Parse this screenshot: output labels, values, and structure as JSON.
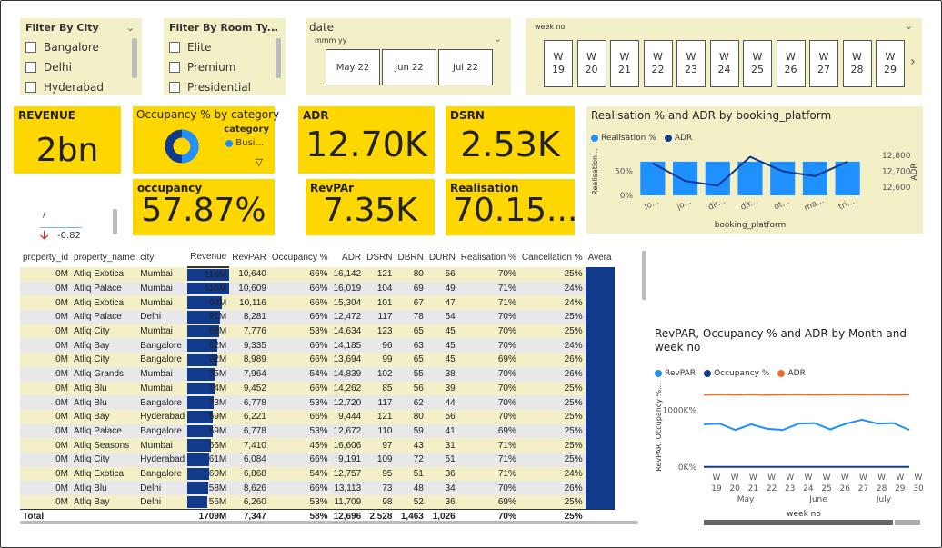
{
  "filters": {
    "city": {
      "title": "Filter By City",
      "items": [
        "Bangalore",
        "Delhi",
        "Hyderabad"
      ]
    },
    "room": {
      "title": "Filter By Room Ty...",
      "items": [
        "Elite",
        "Premium",
        "Presidential"
      ]
    },
    "date": {
      "title": "date",
      "subtitle": "mmm yy",
      "items": [
        "May 22",
        "Jun 22",
        "Jul 22"
      ]
    },
    "week": {
      "title": "week no",
      "items": [
        "19",
        "20",
        "21",
        "22",
        "23",
        "24",
        "25",
        "26",
        "27",
        "28",
        "29"
      ],
      "prefix": "W"
    }
  },
  "kpis": {
    "revenue": {
      "title": "REVENUE",
      "value": "2bn"
    },
    "occ_cat": {
      "title": "Occupancy % by category",
      "legend_title": "category",
      "legend_item": "Busi..."
    },
    "adr": {
      "title": "ADR",
      "value": "12.70K"
    },
    "dsrn": {
      "title": "DSRN",
      "value": "2.53K"
    },
    "occupancy": {
      "title": "occupancy",
      "value": "57.87%"
    },
    "revpar": {
      "title": "RevPAr",
      "value": "7.35K"
    },
    "realisation": {
      "title": "Realisation",
      "value": "70.15..."
    }
  },
  "trend": {
    "delta": "-0.82",
    "symbol": "/"
  },
  "colors": {
    "accent": "#ffd700",
    "panel": "#f3f0c7",
    "navy": "#123a8c",
    "blue": "#1e90ff",
    "orange": "#f26c2a"
  },
  "table": {
    "headers": [
      "property_id",
      "property_name",
      "city",
      "Revenue",
      "RevPAR",
      "Occupancy %",
      "ADR",
      "DSRN",
      "DBRN",
      "DURN",
      "Realisation %",
      "Cancellation %",
      "Avera"
    ],
    "rows": [
      [
        "0M",
        "Atliq Exotica",
        "Mumbai",
        "116M",
        "10,640",
        "66%",
        "16,142",
        "121",
        "80",
        "56",
        "70%",
        "25%"
      ],
      [
        "0M",
        "Atliq Palace",
        "Mumbai",
        "115M",
        "10,609",
        "66%",
        "16,019",
        "104",
        "69",
        "49",
        "71%",
        "24%"
      ],
      [
        "0M",
        "Atliq Exotica",
        "Mumbai",
        "94M",
        "10,116",
        "66%",
        "15,304",
        "101",
        "67",
        "47",
        "71%",
        "24%"
      ],
      [
        "0M",
        "Atliq Palace",
        "Delhi",
        "91M",
        "8,281",
        "66%",
        "12,472",
        "117",
        "78",
        "54",
        "70%",
        "25%"
      ],
      [
        "0M",
        "Atliq City",
        "Mumbai",
        "88M",
        "7,776",
        "53%",
        "14,634",
        "123",
        "65",
        "45",
        "70%",
        "25%"
      ],
      [
        "0M",
        "Atliq Bay",
        "Bangalore",
        "82M",
        "9,335",
        "66%",
        "14,185",
        "96",
        "63",
        "45",
        "70%",
        "24%"
      ],
      [
        "0M",
        "Atliq City",
        "Bangalore",
        "82M",
        "8,989",
        "66%",
        "13,694",
        "99",
        "65",
        "45",
        "69%",
        "26%"
      ],
      [
        "0M",
        "Atliq Grands",
        "Mumbai",
        "75M",
        "7,964",
        "54%",
        "14,839",
        "102",
        "55",
        "38",
        "70%",
        "26%"
      ],
      [
        "0M",
        "Atliq Blu",
        "Mumbai",
        "74M",
        "9,452",
        "66%",
        "14,262",
        "85",
        "56",
        "39",
        "70%",
        "25%"
      ],
      [
        "0M",
        "Atliq Blu",
        "Bangalore",
        "73M",
        "6,778",
        "53%",
        "12,720",
        "117",
        "62",
        "44",
        "70%",
        "25%"
      ],
      [
        "0M",
        "Atliq Bay",
        "Hyderabad",
        "69M",
        "6,221",
        "66%",
        "9,444",
        "121",
        "80",
        "56",
        "70%",
        "25%"
      ],
      [
        "0M",
        "Atliq Palace",
        "Bangalore",
        "69M",
        "6,778",
        "53%",
        "12,672",
        "110",
        "59",
        "41",
        "69%",
        "25%"
      ],
      [
        "0M",
        "Atliq Seasons",
        "Mumbai",
        "66M",
        "7,410",
        "45%",
        "16,606",
        "97",
        "43",
        "31",
        "71%",
        "25%"
      ],
      [
        "0M",
        "Atliq City",
        "Hyderabad",
        "61M",
        "6,084",
        "66%",
        "9,191",
        "109",
        "72",
        "51",
        "71%",
        "25%"
      ],
      [
        "0M",
        "Atliq Exotica",
        "Bangalore",
        "60M",
        "6,868",
        "54%",
        "12,757",
        "95",
        "51",
        "36",
        "71%",
        "24%"
      ],
      [
        "0M",
        "Atliq Blu",
        "Delhi",
        "58M",
        "8,626",
        "66%",
        "13,113",
        "73",
        "48",
        "34",
        "70%",
        "26%"
      ],
      [
        "0M",
        "Atliq Bay",
        "Delhi",
        "56M",
        "6,260",
        "53%",
        "11,709",
        "98",
        "52",
        "36",
        "69%",
        "25%"
      ]
    ],
    "rev_values": [
      116,
      115,
      94,
      91,
      88,
      82,
      82,
      75,
      74,
      73,
      69,
      69,
      66,
      61,
      60,
      58,
      56
    ],
    "total": [
      "Total",
      "",
      "",
      "1709M",
      "7,347",
      "58%",
      "12,696",
      "2,528",
      "1,463",
      "1,026",
      "70%",
      "25%"
    ]
  },
  "chart_data": [
    {
      "type": "bar",
      "title": "Realisation % and ADR by booking_platform",
      "xlabel": "booking_platform",
      "ylabel": "Realisation...",
      "y2label": "ADR",
      "categories": [
        "lo...",
        "jo...",
        "dir...",
        "dir...",
        "ot...",
        "ma...",
        "tri..."
      ],
      "series": [
        {
          "name": "Realisation %",
          "kind": "bar",
          "values": [
            70,
            70,
            70,
            70,
            70,
            70,
            70
          ]
        },
        {
          "name": "ADR",
          "kind": "line",
          "axis": "right",
          "values": [
            12750,
            12640,
            12610,
            12790,
            12700,
            12670,
            12760
          ]
        }
      ],
      "yticks": [
        "50%",
        "0%"
      ],
      "y2ticks": [
        "12,800",
        "12,700",
        "12,600"
      ],
      "ylim": [
        0,
        100
      ],
      "y2lim": [
        12550,
        12850
      ]
    },
    {
      "type": "line",
      "title": "RevPAR, Occupancy % and ADR by Month and week no",
      "ylabel": "RevPAR, Occupancy %...",
      "xlabel": "week no",
      "categories": [
        "W 19",
        "W 20",
        "W 21",
        "W 22",
        "W 23",
        "W 24",
        "W 25",
        "W 26",
        "W 27",
        "W 28",
        "W 29",
        "W 30"
      ],
      "months": [
        "May",
        "June",
        "July"
      ],
      "series": [
        {
          "name": "RevPAR",
          "values": [
            750,
            760,
            650,
            750,
            670,
            650,
            760,
            770,
            660,
            760,
            830,
            760,
            770,
            650
          ]
        },
        {
          "name": "Occupancy %",
          "values": [
            0,
            0,
            0,
            0,
            0,
            0,
            0,
            0,
            0,
            0,
            0,
            0,
            0,
            0
          ]
        },
        {
          "name": "ADR",
          "values": [
            1270,
            1275,
            1270,
            1275,
            1268,
            1272,
            1275,
            1270,
            1272,
            1275,
            1272,
            1275,
            1270,
            1272
          ]
        }
      ],
      "yticks": [
        "1000K%",
        "0K%"
      ],
      "ylim": [
        -100,
        1500
      ]
    }
  ]
}
